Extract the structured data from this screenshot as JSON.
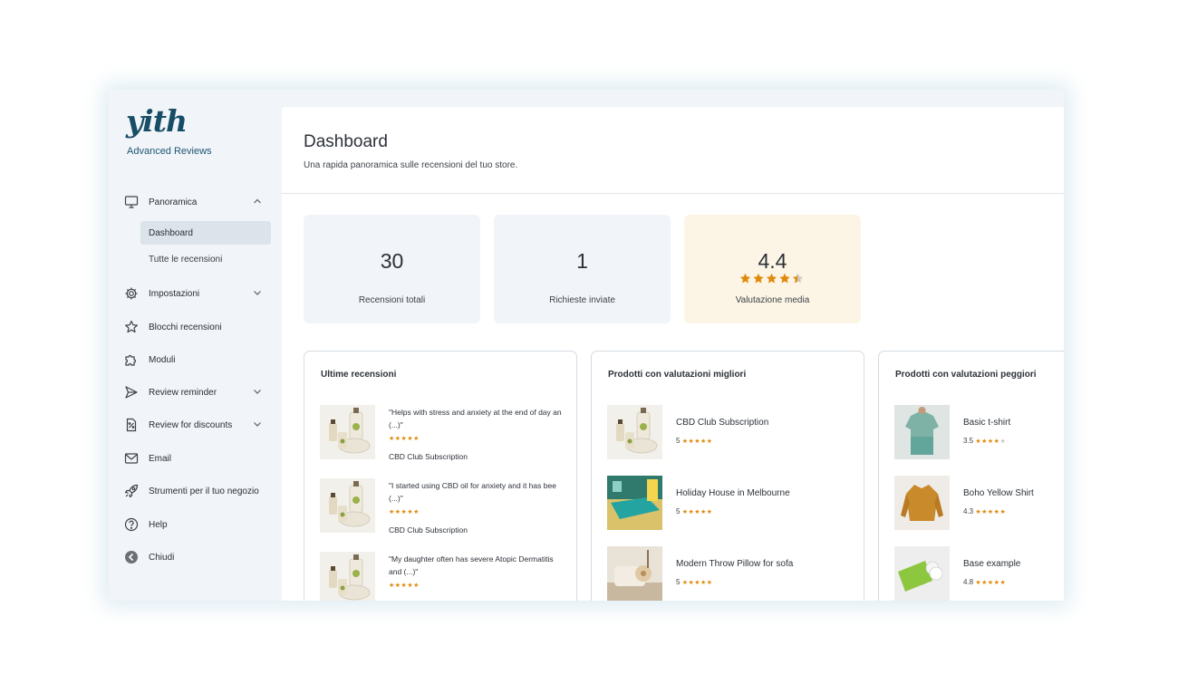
{
  "brand": {
    "logo_text": "yith",
    "plugin_name": "Advanced Reviews",
    "color": "#174e66"
  },
  "sidebar": {
    "items": [
      {
        "label": "Panoramica",
        "icon": "monitor-icon",
        "expanded": true
      },
      {
        "label": "Impostazioni",
        "icon": "gear-icon",
        "expanded": false
      },
      {
        "label": "Blocchi recensioni",
        "icon": "star-outline-icon"
      },
      {
        "label": "Moduli",
        "icon": "puzzle-icon"
      },
      {
        "label": "Review reminder",
        "icon": "send-icon",
        "expanded": false
      },
      {
        "label": "Review for discounts",
        "icon": "discount-icon",
        "expanded": false
      },
      {
        "label": "Email",
        "icon": "envelope-icon"
      },
      {
        "label": "Strumenti per il tuo negozio",
        "icon": "rocket-icon"
      },
      {
        "label": "Help",
        "icon": "help-circle-icon"
      },
      {
        "label": "Chiudi",
        "icon": "arrow-left-circle-icon"
      }
    ],
    "subitems": [
      {
        "label": "Dashboard",
        "active": true
      },
      {
        "label": "Tutte le recensioni",
        "active": false
      }
    ]
  },
  "header": {
    "title": "Dashboard",
    "subtitle": "Una rapida panoramica sulle recensioni del tuo store."
  },
  "stats": [
    {
      "value": "30",
      "label": "Recensioni totali"
    },
    {
      "value": "1",
      "label": "Richieste inviate"
    },
    {
      "value": "4.4",
      "label": "Valutazione media",
      "rating": 4.4
    }
  ],
  "panels": {
    "latest": {
      "title": "Ultime recensioni",
      "reviews": [
        {
          "text": "\"Helps with stress and anxiety at the end of day an (...)\"",
          "stars": "★★★★★",
          "product": "CBD Club Subscription"
        },
        {
          "text": "\"I started using CBD oil for anxiety and it has bee (...)\"",
          "stars": "★★★★★",
          "product": "CBD Club Subscription"
        },
        {
          "text": "\"My daughter often has severe Atopic Dermatitis and (...)\"",
          "stars": "★★★★★",
          "product": ""
        }
      ]
    },
    "top": {
      "title": "Prodotti con valutazioni migliori",
      "products": [
        {
          "name": "CBD Club Subscription",
          "rating": "5",
          "stars_on": "★★★★★",
          "stars_off": ""
        },
        {
          "name": "Holiday House in Melbourne",
          "rating": "5",
          "stars_on": "★★★★★",
          "stars_off": ""
        },
        {
          "name": "Modern Throw Pillow for sofa",
          "rating": "5",
          "stars_on": "★★★★★",
          "stars_off": ""
        }
      ]
    },
    "worst": {
      "title": "Prodotti con valutazioni peggiori",
      "products": [
        {
          "name": "Basic t-shirt",
          "rating": "3.5",
          "stars_on": "★★★★",
          "stars_off": "★"
        },
        {
          "name": "Boho Yellow Shirt",
          "rating": "4.3",
          "stars_on": "★★★★★",
          "stars_off": ""
        },
        {
          "name": "Base example",
          "rating": "4.8",
          "stars_on": "★★★★★",
          "stars_off": ""
        }
      ]
    }
  },
  "colors": {
    "accent": "#174e66",
    "star": "#e08a0b",
    "gold_card": "#fcf5e5",
    "card": "#f1f4f8"
  }
}
